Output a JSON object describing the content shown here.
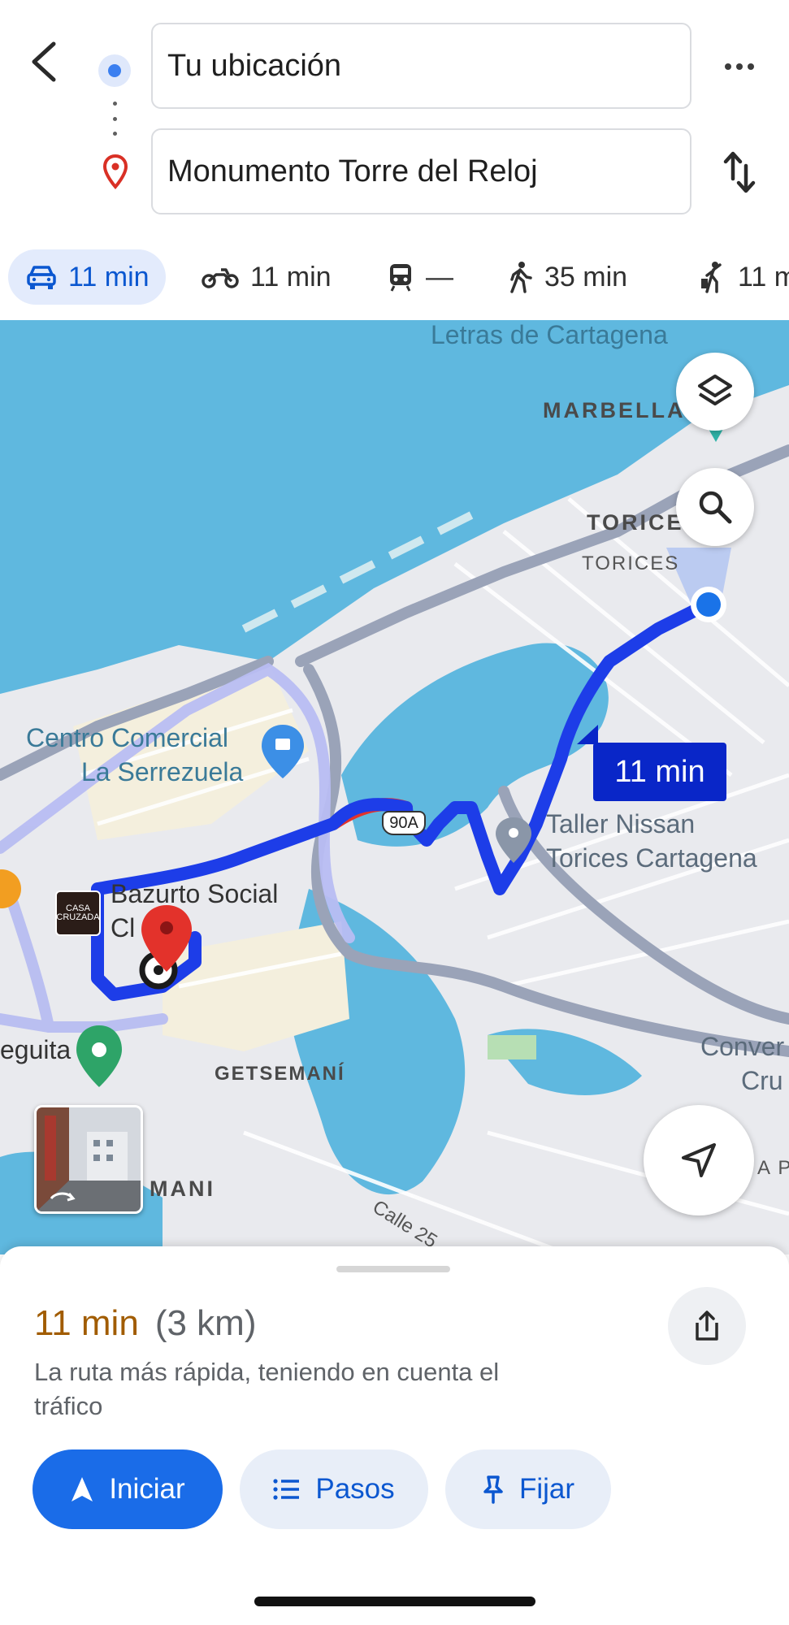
{
  "search": {
    "origin_value": "Tu ubicación",
    "destination_value": "Monumento Torre del Reloj"
  },
  "modes": [
    {
      "icon": "car-icon",
      "time": "11 min",
      "active": true
    },
    {
      "icon": "motorcycle-icon",
      "time": "11 min",
      "active": false
    },
    {
      "icon": "transit-icon",
      "time": "—",
      "active": false
    },
    {
      "icon": "walk-icon",
      "time": "35 min",
      "active": false
    },
    {
      "icon": "ride-hailing-icon",
      "time": "11 m",
      "active": false
    }
  ],
  "map": {
    "labels": {
      "letras": "Letras de Cartagena",
      "marbella": "MARBELLA",
      "torices_big": "TORICES",
      "torices_small": "TORICES",
      "centro_comercial": "Centro Comercial",
      "serrezuela": "La Serrezuela",
      "taller1": "Taller Nissan",
      "taller2": "Torices Cartagena",
      "bazurto1": "Bazurto Social",
      "bazurto2": "Cl",
      "getsemani": "GETSEMANÍ",
      "mani": "MANI",
      "eguita": "eguita",
      "conv1": "Conver",
      "conv2": "Cru",
      "ap": "A P",
      "calle": "Calle 25",
      "casa_logo": "CASA CRUZADA"
    },
    "route_time": "11 min",
    "highway_shield": "90A",
    "colors": {
      "route": "#1d3de8",
      "traffic": "#e3322b",
      "water": "#5fb8df",
      "land": "#e9eaee"
    }
  },
  "sheet": {
    "eta": "11 min",
    "distance": "(3 km)",
    "description": "La ruta más rápida, teniendo en cuenta el tráfico",
    "start_label": "Iniciar",
    "steps_label": "Pasos",
    "pin_label": "Fijar"
  }
}
